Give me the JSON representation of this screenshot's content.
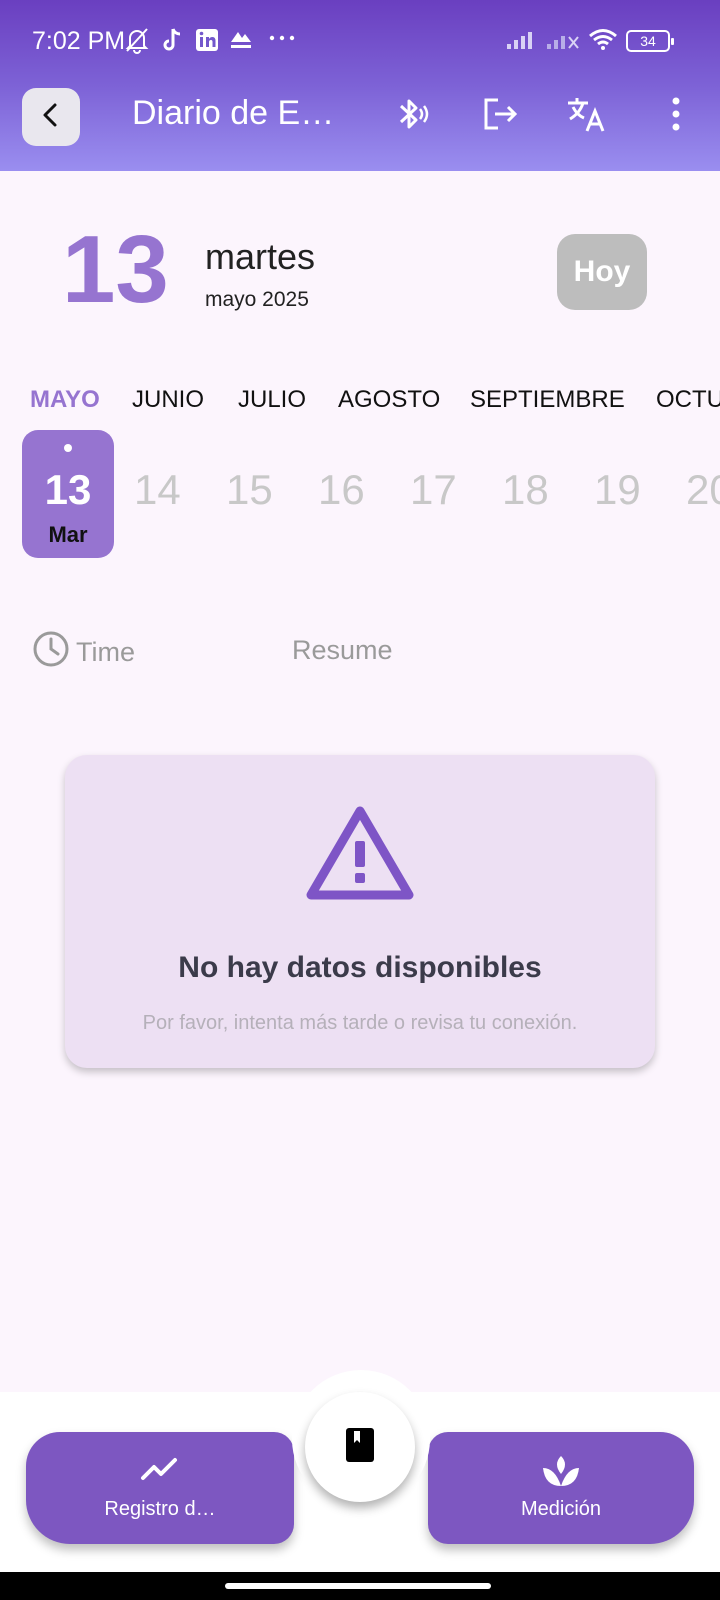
{
  "status_bar": {
    "time": "7:02 PM",
    "left_icons": [
      "bell-off-icon",
      "tiktok-icon",
      "linkedin-icon",
      "app-icon",
      "more-dots-icon"
    ],
    "right_icons": [
      "signal-icon",
      "signal-off-icon",
      "wifi-icon"
    ],
    "battery": "34"
  },
  "app_bar": {
    "title": "Diario de E…",
    "actions": [
      "bluetooth-icon",
      "logout-icon",
      "translate-icon",
      "more-vert-icon"
    ]
  },
  "date_header": {
    "day": "13",
    "weekday": "martes",
    "month_year": "mayo 2025",
    "today_label": "Hoy"
  },
  "months": {
    "items": [
      "MAYO",
      "JUNIO",
      "JULIO",
      "AGOSTO",
      "SEPTIEMBRE",
      "OCTU"
    ],
    "active": "MAYO"
  },
  "days": {
    "selected": {
      "num": "13",
      "abbr": "Mar"
    },
    "others": [
      "14",
      "15",
      "16",
      "17",
      "18",
      "19",
      "20"
    ]
  },
  "tabs": {
    "time": "Time",
    "resume": "Resume"
  },
  "empty_state": {
    "title": "No hay datos disponibles",
    "subtitle": "Por favor, intenta más tarde o revisa tu conexión."
  },
  "bottom_nav": {
    "left_label": "Registro d…",
    "right_label": "Medición"
  },
  "colors": {
    "accent": "#9674d0",
    "nav": "#7d57c1",
    "header_top": "#6a3fc0",
    "header_bottom": "#9a8ef0",
    "background": "#fcf5fd"
  }
}
